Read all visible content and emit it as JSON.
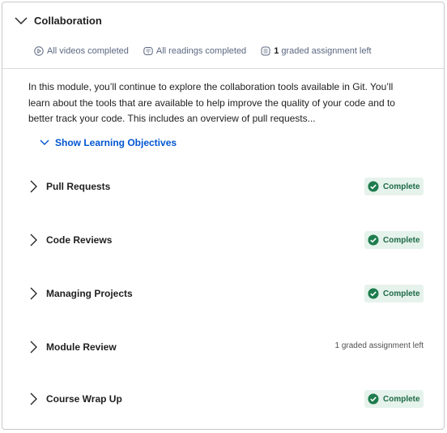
{
  "module": {
    "title": "Collaboration",
    "stats": {
      "videos": "All videos completed",
      "readings": "All readings completed",
      "graded_count": "1",
      "graded_text": "graded assignment left"
    },
    "description": "In this module, you’ll continue to explore the collaboration tools available in Git. You’ll learn about the tools that are available to help improve the quality of your code and to better track your code. This includes an overview of pull requests...",
    "objectives_label": "Show Learning Objectives"
  },
  "lessons": [
    {
      "title": "Pull Requests",
      "status": "Complete"
    },
    {
      "title": "Code Reviews",
      "status": "Complete"
    },
    {
      "title": "Managing Projects",
      "status": "Complete"
    },
    {
      "title": "Module Review",
      "pending": "1 graded assignment left"
    },
    {
      "title": "Course Wrap Up",
      "status": "Complete"
    }
  ],
  "colors": {
    "link": "#0056d2",
    "complete_bg": "#e6f2ec",
    "complete_icon": "#1d7c4d"
  },
  "icons": {
    "module_toggle": "chevron-down-icon",
    "lesson_toggle": "chevron-right-icon",
    "videos": "play-circle-icon",
    "readings": "book-icon",
    "graded": "assignment-icon",
    "complete": "check-circle-icon"
  }
}
